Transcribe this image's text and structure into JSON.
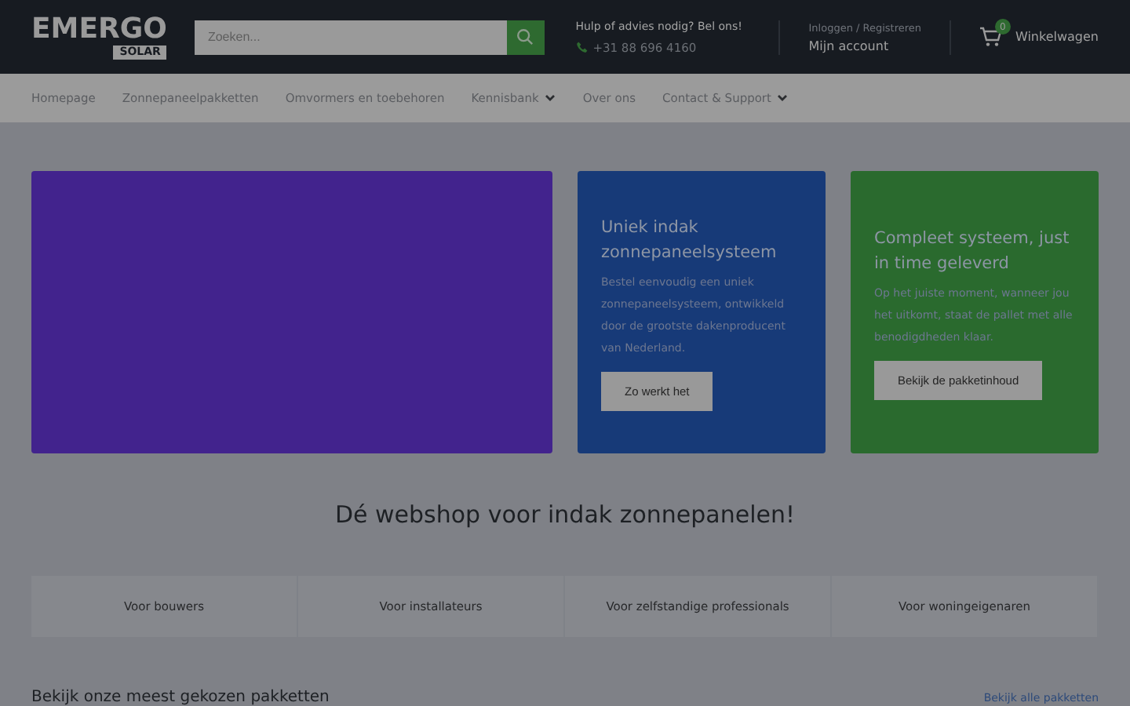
{
  "header": {
    "logo": {
      "main": "EMERGO",
      "sub": "SOLAR"
    },
    "search": {
      "placeholder": "Zoeken..."
    },
    "help": {
      "title": "Hulp of advies nodig? Bel ons!",
      "phone": "+31 88 696 4160"
    },
    "account": {
      "login": "Inloggen / Registreren",
      "label": "Mijn account"
    },
    "cart": {
      "count": "0",
      "label": "Winkelwagen"
    }
  },
  "nav": [
    {
      "label": "Homepage",
      "dropdown": false
    },
    {
      "label": "Zonnepaneelpakketten",
      "dropdown": false
    },
    {
      "label": "Omvormers en toebehoren",
      "dropdown": false
    },
    {
      "label": "Kennisbank",
      "dropdown": true
    },
    {
      "label": "Over ons",
      "dropdown": false
    },
    {
      "label": "Contact & Support",
      "dropdown": true
    }
  ],
  "promo_cards": [
    {
      "title": "Uniek indak zonnepaneelsysteem",
      "text": "Bestel eenvoudig een uniek zonnepaneelsysteem, ontwikkeld door de grootste dakenproducent van Nederland.",
      "button": "Zo werkt het",
      "color": "#173a78"
    },
    {
      "title": "Compleet systeem, just in time geleverd",
      "text": "Op het juiste moment, wanneer jou het uitkomt, staat de pallet met alle benodigdheden klaar.",
      "button": "Bekijk de pakketinhoud",
      "color": "#2a6a2e"
    }
  ],
  "heading": "Dé webshop voor indak zonnepanelen!",
  "audience_tabs": [
    {
      "label": "Voor bouwers",
      "selected": false
    },
    {
      "label": "Voor installateurs",
      "selected": false
    },
    {
      "label": "Voor zelfstandige professionals",
      "selected": false
    },
    {
      "label": "Voor woningeigenaren",
      "selected": false
    }
  ],
  "section": {
    "title": "Bekijk onze meest gekozen pakketten",
    "link": "Bekijk alle pakketten"
  }
}
